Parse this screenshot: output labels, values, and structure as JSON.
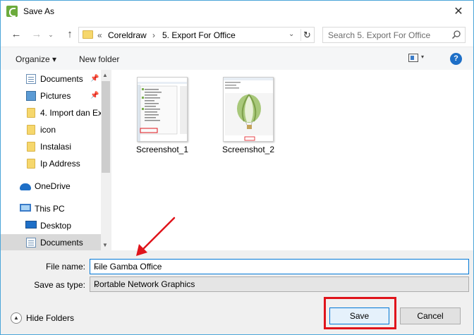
{
  "window": {
    "title": "Save As",
    "close_glyph": "✕"
  },
  "navbar": {
    "back_glyph": "←",
    "forward_glyph": "→",
    "recent_glyph": "⌄",
    "up_glyph": "↑",
    "breadcrumb_prefix": "«",
    "breadcrumbs": [
      "Coreldraw",
      "5. Export For Office"
    ],
    "separator": "›",
    "dropdown_glyph": "⌄",
    "refresh_glyph": "↻",
    "search_placeholder": "Search 5. Export For Office"
  },
  "toolbar": {
    "organize_label": "Organize ▾",
    "new_folder_label": "New folder",
    "view_drop_glyph": "▾",
    "help_label": "?"
  },
  "navpane": {
    "items": [
      {
        "label": "Documents",
        "icon": "document-icon",
        "pinned": true
      },
      {
        "label": "Pictures",
        "icon": "pictures-icon",
        "pinned": true
      },
      {
        "label": "4. Import dan Ex",
        "icon": "folder-icon",
        "pinned": false
      },
      {
        "label": "icon",
        "icon": "folder-icon",
        "pinned": false
      },
      {
        "label": "Instalasi",
        "icon": "folder-icon",
        "pinned": false
      },
      {
        "label": "Ip Address",
        "icon": "folder-icon",
        "pinned": false
      },
      {
        "label": "OneDrive",
        "icon": "onedrive-icon",
        "pinned": false
      },
      {
        "label": "This PC",
        "icon": "computer-icon",
        "pinned": false
      },
      {
        "label": "Desktop",
        "icon": "desktop-icon",
        "pinned": false
      },
      {
        "label": "Documents",
        "icon": "document-icon",
        "pinned": false
      }
    ],
    "pin_glyph": "📌",
    "scroll_up": "▲",
    "scroll_down": "▼"
  },
  "files": [
    {
      "name": "Screenshot_1"
    },
    {
      "name": "Screenshot_2"
    }
  ],
  "form": {
    "filename_label": "File name:",
    "filename_value": "File Gamba Office",
    "savetype_label": "Save as type:",
    "savetype_value": "Portable Network Graphics",
    "chevron": "⌄"
  },
  "footer": {
    "hide_folders_label": "Hide Folders",
    "hide_glyph": "▲",
    "save_label": "Save",
    "cancel_label": "Cancel"
  },
  "colors": {
    "accent": "#0078d7",
    "highlight_red": "#e0141b",
    "folder": "#f6d76c"
  }
}
